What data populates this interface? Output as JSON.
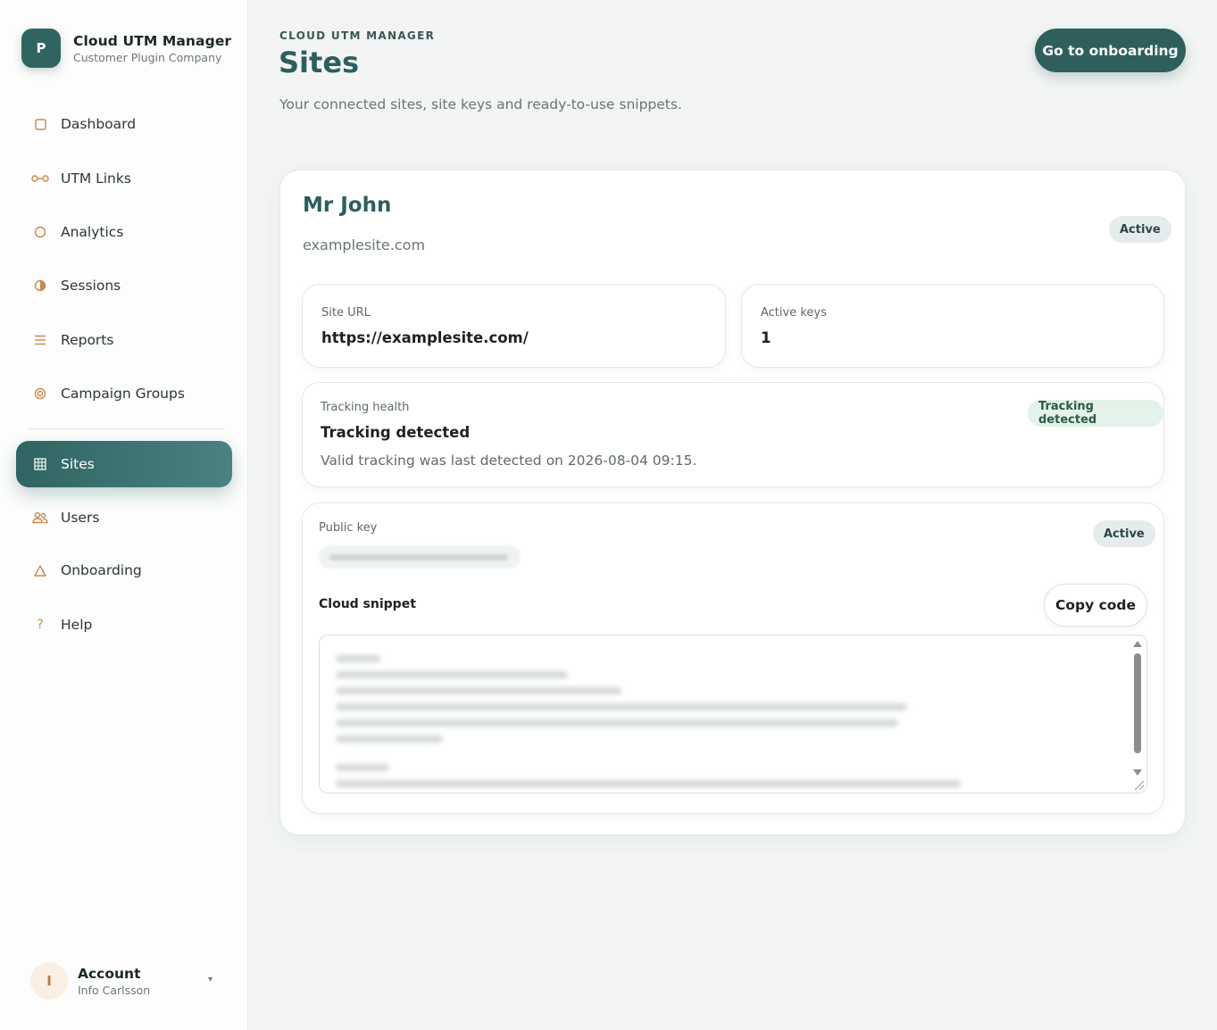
{
  "brand": {
    "logo_letter": "P",
    "title": "Cloud UTM Manager",
    "subtitle": "Customer Plugin Company"
  },
  "nav": {
    "items": [
      {
        "label": "Dashboard",
        "icon": "square-icon"
      },
      {
        "label": "UTM Links",
        "icon": "link-icon"
      },
      {
        "label": "Analytics",
        "icon": "circle-icon"
      },
      {
        "label": "Sessions",
        "icon": "half-circle-icon"
      },
      {
        "label": "Reports",
        "icon": "list-icon"
      },
      {
        "label": "Campaign Groups",
        "icon": "target-icon"
      },
      {
        "label": "Sites",
        "icon": "grid-icon",
        "active": true
      },
      {
        "label": "Users",
        "icon": "users-icon"
      },
      {
        "label": "Onboarding",
        "icon": "triangle-icon"
      },
      {
        "label": "Help",
        "icon": "question-icon"
      }
    ]
  },
  "account": {
    "avatar_letter": "I",
    "label": "Account",
    "name": "Info Carlsson",
    "caret": "▾"
  },
  "header": {
    "eyebrow": "CLOUD UTM MANAGER",
    "title": "Sites",
    "subtitle": "Your connected sites, site keys and ready-to-use snippets.",
    "onboarding_button": "Go to onboarding"
  },
  "site": {
    "name": "Mr John",
    "domain": "examplesite.com",
    "status": "Active",
    "url_label": "Site URL",
    "url_value": "https://examplesite.com/",
    "keys_label": "Active keys",
    "keys_value": "1",
    "health": {
      "label": "Tracking health",
      "title": "Tracking detected",
      "description": "Valid tracking was last detected on 2026-08-04 09:15.",
      "badge": "Tracking detected"
    },
    "key": {
      "label": "Public key",
      "status": "Active",
      "snippet_label": "Cloud snippet",
      "copy_button": "Copy code"
    }
  },
  "colors": {
    "accent": "#2f6463",
    "icon": "#c98a4a",
    "success_bg": "#e3f2ea",
    "background": "#f2f5f4"
  }
}
